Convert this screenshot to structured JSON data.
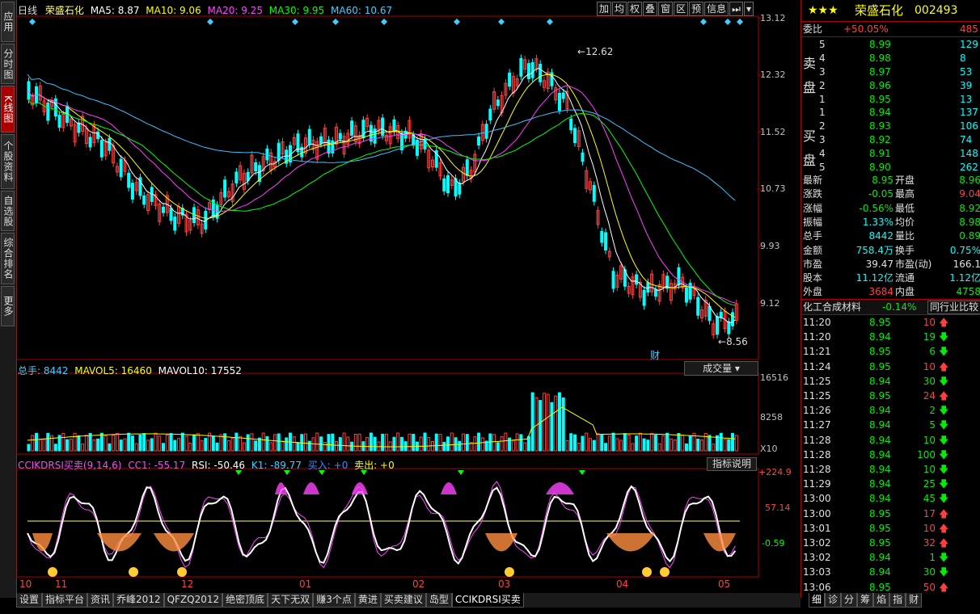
{
  "left_tabs": [
    "应用",
    "分时图",
    "K线图",
    "个股资料",
    "自选股",
    "综合排名",
    "更多"
  ],
  "chart_header": {
    "period": "日线",
    "stock": "荣盛石化",
    "ma5": "MA5: 8.87",
    "ma10": "MA10: 9.06",
    "ma20": "MA20: 9.25",
    "ma30": "MA30: 9.95",
    "ma60": "MA60: 10.67"
  },
  "toolbar": [
    "加",
    "均",
    "权",
    "叠",
    "窗",
    "区",
    "预",
    "信息"
  ],
  "price_axis": [
    "13.12",
    "12.32",
    "11.52",
    "10.73",
    "9.93",
    "9.12"
  ],
  "annotations": {
    "high": "12.62",
    "low": "8.56",
    "cai": "财"
  },
  "vol_header": {
    "total": "总手: 8442",
    "mavol5": "MAVOL5: 16460",
    "mavol10": "MAVOL10: 17552",
    "dropdown": "成交量"
  },
  "vol_axis": [
    "16516",
    "8258",
    "X10"
  ],
  "ind_header": {
    "name": "CCIKDRSI买卖(9,14,6)",
    "cc1": "CC1: -55.17",
    "rsi": "RSI: -50.46",
    "k1": "K1: -89.77",
    "buy": "买入: +0",
    "sell": "卖出: +0",
    "btn": "指标说明"
  },
  "ind_axis": [
    "+224.9",
    "57.14",
    "-0.59"
  ],
  "date_axis": [
    "10",
    "11",
    "12",
    "01",
    "02",
    "03",
    "04",
    "05"
  ],
  "bottom_tabs": [
    "设置",
    "指标平台",
    "资讯",
    "乔峰2012",
    "QFZQ2012",
    "绝密顶底",
    "天下无双",
    "赚3个点",
    "黄进",
    "买卖建议",
    "岛型",
    "CCIKDRSI买卖"
  ],
  "right_tabs": [
    "细",
    "诊",
    "分",
    "筹",
    "焰",
    "指",
    "财"
  ],
  "quote": {
    "title": "荣盛石化",
    "code": "002493",
    "weibi_label": "委比",
    "weibi": "+50.05%",
    "weibi_right": "485",
    "sell_label": "卖盘",
    "buy_label": "买盘",
    "asks": [
      {
        "lv": "5",
        "p": "8.99",
        "v": "129"
      },
      {
        "lv": "4",
        "p": "8.98",
        "v": "8"
      },
      {
        "lv": "3",
        "p": "8.97",
        "v": "53"
      },
      {
        "lv": "2",
        "p": "8.96",
        "v": "39"
      },
      {
        "lv": "1",
        "p": "8.95",
        "v": "13"
      }
    ],
    "bids": [
      {
        "lv": "1",
        "p": "8.94",
        "v": "137"
      },
      {
        "lv": "2",
        "p": "8.93",
        "v": "106"
      },
      {
        "lv": "3",
        "p": "8.92",
        "v": "74"
      },
      {
        "lv": "4",
        "p": "8.91",
        "v": "148"
      },
      {
        "lv": "5",
        "p": "8.90",
        "v": "262"
      }
    ],
    "stats": [
      {
        "l1": "最新",
        "v1": "8.95",
        "c1": "grn",
        "l2": "开盘",
        "v2": "8.96",
        "c2": "grn"
      },
      {
        "l1": "涨跌",
        "v1": "-0.05",
        "c1": "grn",
        "l2": "最高",
        "v2": "9.04",
        "c2": "red"
      },
      {
        "l1": "涨幅",
        "v1": "-0.56%",
        "c1": "grn",
        "l2": "最低",
        "v2": "8.92",
        "c2": "grn"
      },
      {
        "l1": "振幅",
        "v1": "1.33%",
        "c1": "cyn",
        "l2": "均价",
        "v2": "8.98",
        "c2": "grn"
      },
      {
        "l1": "总手",
        "v1": "8442",
        "c1": "cyn",
        "l2": "量比",
        "v2": "0.89",
        "c2": "grn"
      },
      {
        "l1": "金额",
        "v1": "758.4万",
        "c1": "cyn",
        "l2": "换手",
        "v2": "0.75%",
        "c2": "cyn"
      },
      {
        "l1": "市盈",
        "v1": "39.47",
        "c1": "wht",
        "l2": "市盈(动)",
        "v2": "166.1",
        "c2": "wht"
      },
      {
        "l1": "股本",
        "v1": "11.12亿",
        "c1": "cyn",
        "l2": "流通",
        "v2": "1.12亿",
        "c2": "cyn"
      },
      {
        "l1": "外盘",
        "v1": "3684",
        "c1": "red",
        "l2": "内盘",
        "v2": "4758",
        "c2": "grn"
      }
    ],
    "sector": "化工合成材料",
    "sector_chg": "-0.14%",
    "sector_btn": "同行业比较",
    "ticks": [
      {
        "t": "11:20",
        "p": "8.95",
        "v": "10",
        "d": "up"
      },
      {
        "t": "11:20",
        "p": "8.94",
        "v": "19",
        "d": "down"
      },
      {
        "t": "11:21",
        "p": "8.95",
        "v": "6",
        "d": "down"
      },
      {
        "t": "11:24",
        "p": "8.95",
        "v": "10",
        "d": "up"
      },
      {
        "t": "11:25",
        "p": "8.94",
        "v": "30",
        "d": "down"
      },
      {
        "t": "11:25",
        "p": "8.95",
        "v": "24",
        "d": "up"
      },
      {
        "t": "11:26",
        "p": "8.94",
        "v": "2",
        "d": "down"
      },
      {
        "t": "11:27",
        "p": "8.94",
        "v": "5",
        "d": "down"
      },
      {
        "t": "11:28",
        "p": "8.94",
        "v": "10",
        "d": "down"
      },
      {
        "t": "11:28",
        "p": "8.94",
        "v": "100",
        "d": "down"
      },
      {
        "t": "11:28",
        "p": "8.94",
        "v": "10",
        "d": "down"
      },
      {
        "t": "11:29",
        "p": "8.94",
        "v": "25",
        "d": "down"
      },
      {
        "t": "13:00",
        "p": "8.94",
        "v": "45",
        "d": "down"
      },
      {
        "t": "13:00",
        "p": "8.95",
        "v": "17",
        "d": "up"
      },
      {
        "t": "13:01",
        "p": "8.95",
        "v": "10",
        "d": "up"
      },
      {
        "t": "13:02",
        "p": "8.95",
        "v": "32",
        "d": "up"
      },
      {
        "t": "13:02",
        "p": "8.94",
        "v": "1",
        "d": "down"
      },
      {
        "t": "13:03",
        "p": "8.94",
        "v": "30",
        "d": "down"
      },
      {
        "t": "13:06",
        "p": "8.95",
        "v": "50",
        "d": "up"
      }
    ]
  },
  "colors": {
    "up": "#ff4040",
    "down": "#00ffff",
    "ma5": "#ffffff",
    "ma10": "#ffff00",
    "ma20": "#ff40ff",
    "ma30": "#00ff00",
    "ma60": "#40c0ff"
  }
}
